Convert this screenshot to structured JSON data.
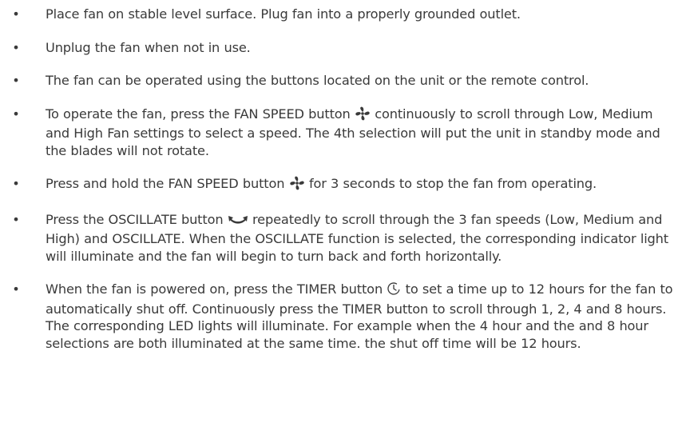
{
  "document": {
    "bullet_glyph": "•",
    "items": [
      {
        "text": "Place fan on stable level surface. Plug fan into a properly grounded outlet."
      },
      {
        "text": "Unplug the fan when not in use."
      },
      {
        "text": "The fan can be operated using the buttons located on the unit or the remote control."
      },
      {
        "before": "To operate the fan, press the FAN SPEED button",
        "icon": "fan-icon",
        "after": "continuously to scroll through Low, Medium and High Fan settings to select a speed. The 4th selection will put the unit in standby mode and the blades will not rotate."
      },
      {
        "before": "Press and hold the FAN SPEED button",
        "icon": "fan-icon",
        "after": "for 3 seconds to stop the fan from operating."
      },
      {
        "before": "Press the OSCILLATE button",
        "icon": "oscillate-icon",
        "after": "repeatedly to scroll through the 3 fan speeds (Low, Medium and High) and OSCILLATE. When the OSCILLATE function is selected, the corresponding indicator light will illuminate and the fan will begin to turn back and forth horizontally."
      },
      {
        "before": "When the fan is powered on, press the TIMER button",
        "icon": "timer-icon",
        "after": "to set a time up to 12 hours for the fan to automatically shut off. Continuously press the TIMER button to scroll through 1, 2, 4 and 8 hours. The corresponding LED lights will illuminate. For example when the 4 hour and the and 8 hour selections are both illuminated at the same time. the shut off time will be 12 hours."
      }
    ]
  },
  "colors": {
    "text": "#3a3a3a",
    "background": "#ffffff"
  }
}
